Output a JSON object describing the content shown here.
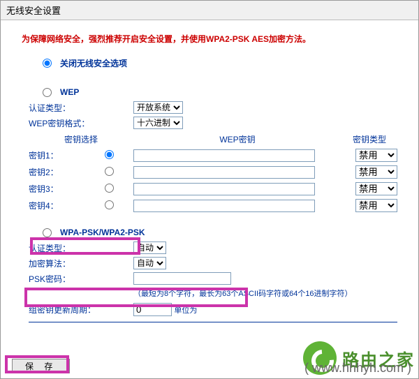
{
  "title": "无线安全设置",
  "warning": "为保障网络安全，强烈推荐开启安全设置，并使用WPA2-PSK AES加密方法。",
  "radio_disable": "关闭无线安全选项",
  "radio_wep": "WEP",
  "radio_wpa": "WPA-PSK/WPA2-PSK",
  "auth_type_label": "认证类型：",
  "auth_type_open": "开放系统",
  "wep_key_format_label": "WEP密钥格式：",
  "wep_key_format_hex": "十六进制",
  "key_select_label": "密钥选择",
  "wep_key_header": "WEP密钥",
  "key_type_header": "密钥类型",
  "key1": "密钥1：",
  "key2": "密钥2：",
  "key3": "密钥3：",
  "key4": "密钥4：",
  "key_type_disabled": "禁用",
  "wpa_auth_label": "认证类型：",
  "wpa_auth_auto": "自动",
  "wpa_encrypt_label": "加密算法：",
  "wpa_encrypt_auto": "自动",
  "psk_label": "PSK密码：",
  "psk_hint": "（最短为8个字符，最长为63个ASCII码字符或64个16进制字符）",
  "group_key_label": "组密钥更新周期：",
  "group_key_value": "0",
  "group_key_unit": "单位为",
  "save_label": "保 存",
  "wm_brand": "路由之家",
  "wm_url": "( www.hhhyh.com )"
}
